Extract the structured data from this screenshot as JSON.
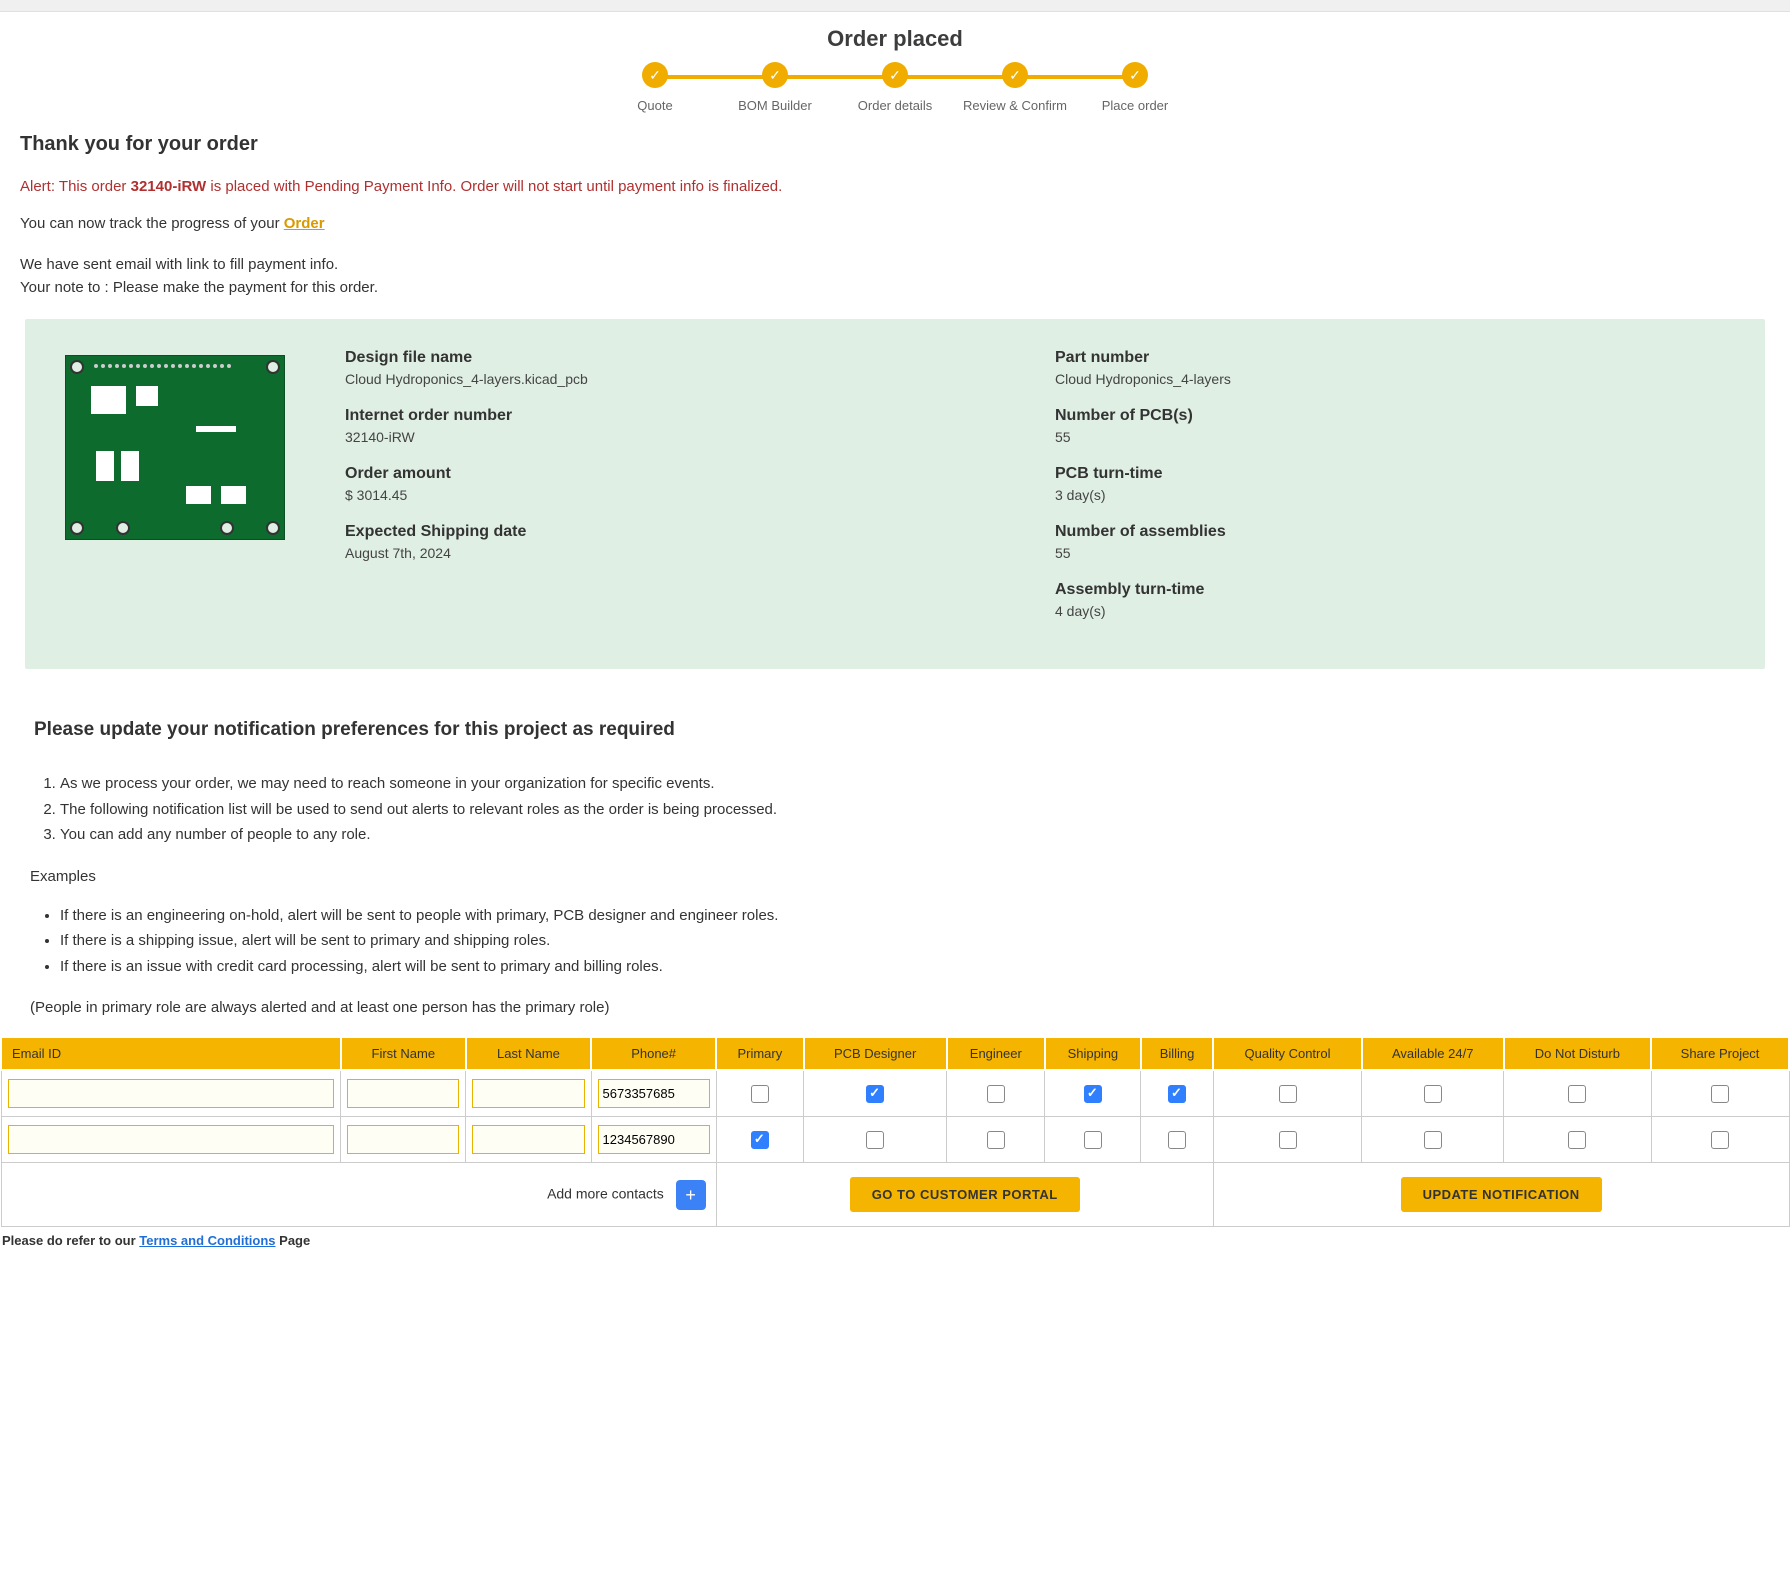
{
  "page_title": "Order placed",
  "stepper": [
    "Quote",
    "BOM Builder",
    "Order details",
    "Review & Confirm",
    "Place order"
  ],
  "thank_you": "Thank you for your order",
  "alert": {
    "prefix": "Alert: This order ",
    "order_num": "32140-iRW",
    "suffix": " is placed with Pending Payment Info. Order will not start until payment info is finalized."
  },
  "track": {
    "prefix": "You can now track the progress of your ",
    "link": "Order"
  },
  "email_line1": "We have sent email with link to fill payment info.",
  "email_line2": "Your note to : Please make the payment for this order.",
  "summary": {
    "design_file_name": {
      "label": "Design file name",
      "value": "Cloud Hydroponics_4-layers.kicad_pcb"
    },
    "internet_order_number": {
      "label": "Internet order number",
      "value": "32140-iRW"
    },
    "order_amount": {
      "label": "Order amount",
      "value": "$ 3014.45"
    },
    "expected_shipping": {
      "label": "Expected Shipping date",
      "value": "August 7th, 2024"
    },
    "part_number": {
      "label": "Part number",
      "value": "Cloud Hydroponics_4-layers"
    },
    "number_of_pcbs": {
      "label": "Number of PCB(s)",
      "value": "55"
    },
    "pcb_turn_time": {
      "label": "PCB turn-time",
      "value": "3 day(s)"
    },
    "number_of_assemblies": {
      "label": "Number of assemblies",
      "value": "55"
    },
    "assembly_turn_time": {
      "label": "Assembly turn-time",
      "value": "4 day(s)"
    }
  },
  "notif_heading": "Please update your notification preferences for this project as required",
  "notif_list": [
    "As we process your order, we may need to reach someone in your organization for specific events.",
    "The following notification list will be used to send out alerts to relevant roles as the order is being processed.",
    "You can add any number of people to any role."
  ],
  "examples_label": "Examples",
  "examples_list": [
    "If there is an engineering on-hold, alert will be sent to people with primary, PCB designer and engineer roles.",
    "If there is a shipping issue, alert will be sent to primary and shipping roles.",
    "If there is an issue with credit card processing, alert will be sent to primary and billing roles."
  ],
  "note_line": "(People in primary role are always alerted and at least one person has the primary role)",
  "table": {
    "headers": [
      "Email ID",
      "First Name",
      "Last Name",
      "Phone#",
      "Primary",
      "PCB Designer",
      "Engineer",
      "Shipping",
      "Billing",
      "Quality Control",
      "Available 24/7",
      "Do Not Disturb",
      "Share Project"
    ],
    "rows": [
      {
        "email": "",
        "first": "",
        "last": "",
        "phone": "5673357685",
        "checks": [
          false,
          true,
          false,
          true,
          true,
          false,
          false,
          false,
          false
        ]
      },
      {
        "email": "",
        "first": "",
        "last": "",
        "phone": "1234567890",
        "checks": [
          true,
          false,
          false,
          false,
          false,
          false,
          false,
          false,
          false
        ]
      }
    ]
  },
  "add_contacts_label": "Add more contacts",
  "go_portal_btn": "GO TO CUSTOMER PORTAL",
  "update_notif_btn": "UPDATE NOTIFICATION",
  "terms": {
    "prefix": "Please do refer to our ",
    "link": "Terms and Conditions",
    "suffix": " Page"
  }
}
